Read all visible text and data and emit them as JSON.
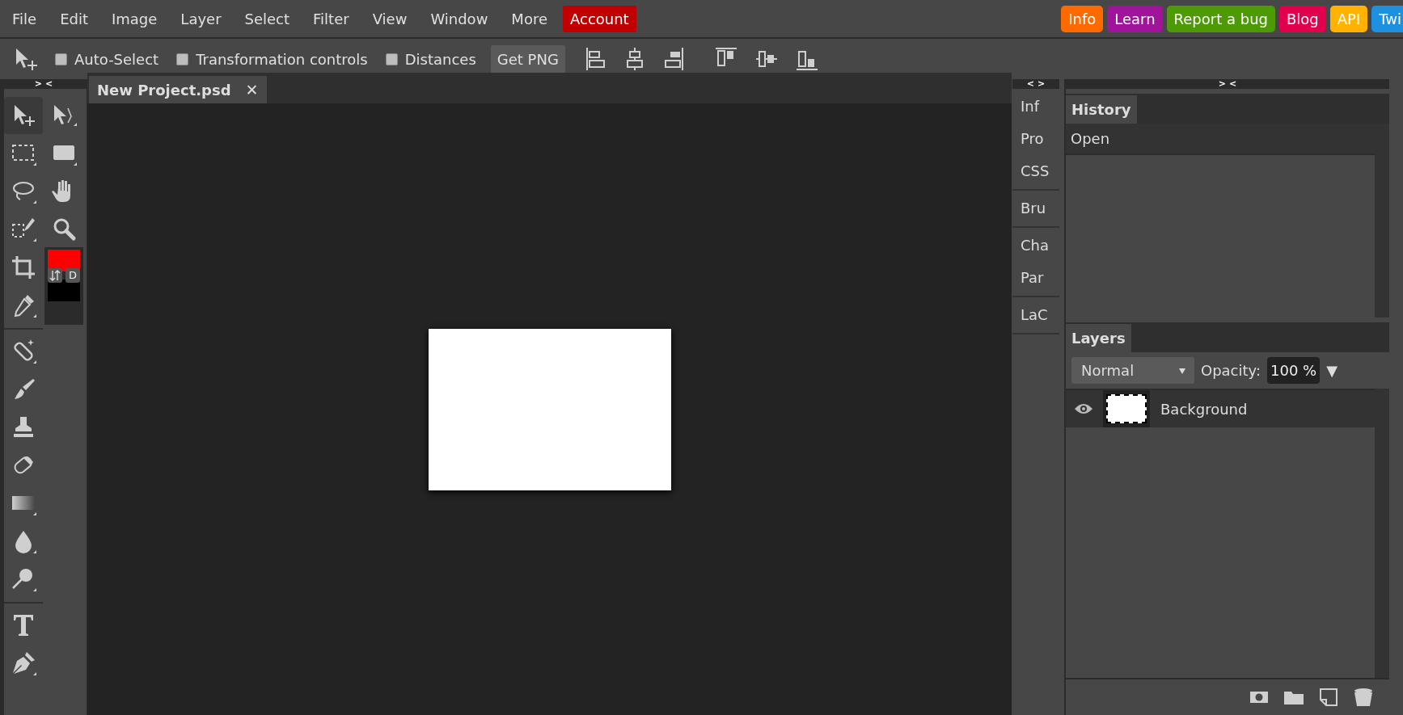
{
  "menu": [
    {
      "label": "File"
    },
    {
      "label": "Edit"
    },
    {
      "label": "Image"
    },
    {
      "label": "Layer"
    },
    {
      "label": "Select"
    },
    {
      "label": "Filter"
    },
    {
      "label": "View"
    },
    {
      "label": "Window"
    },
    {
      "label": "More"
    }
  ],
  "account": {
    "label": "Account",
    "color": "#c00000"
  },
  "links": [
    {
      "label": "Info",
      "color": "#ff6a00"
    },
    {
      "label": "Learn",
      "color": "#a0149c"
    },
    {
      "label": "Report a bug",
      "color": "#4e9a06"
    },
    {
      "label": "Blog",
      "color": "#e0004d"
    },
    {
      "label": "API",
      "color": "#ffb300"
    },
    {
      "label": "Twi",
      "color": "#1e90e0"
    }
  ],
  "options": {
    "checkboxes": [
      {
        "label": "Auto-Select",
        "checked": false
      },
      {
        "label": "Transformation controls",
        "checked": false
      },
      {
        "label": "Distances",
        "checked": false
      }
    ],
    "button": "Get PNG"
  },
  "left_collapse": "> <",
  "document_tab": {
    "title": "New Project.psd",
    "close": "✕"
  },
  "swatches": {
    "foreground": {
      "color": "#ff0000"
    },
    "background": {
      "color": "#000000"
    },
    "default_label": "D"
  },
  "side_collapse": "< >",
  "side_panels": [
    [
      "Inf",
      "Pro",
      "CSS"
    ],
    [
      "Bru"
    ],
    [
      "Cha",
      "Par"
    ],
    [
      "LaC"
    ]
  ],
  "right_collapse": "> <",
  "history": {
    "title": "History",
    "items": [
      {
        "label": "Open",
        "selected": true
      }
    ]
  },
  "layers": {
    "title": "Layers",
    "blend_mode": "Normal",
    "opacity_label": "Opacity:",
    "opacity": "100 %",
    "opacity_arrow": "▼",
    "items": [
      {
        "name": "Background",
        "visible": true,
        "selected": true
      }
    ]
  }
}
